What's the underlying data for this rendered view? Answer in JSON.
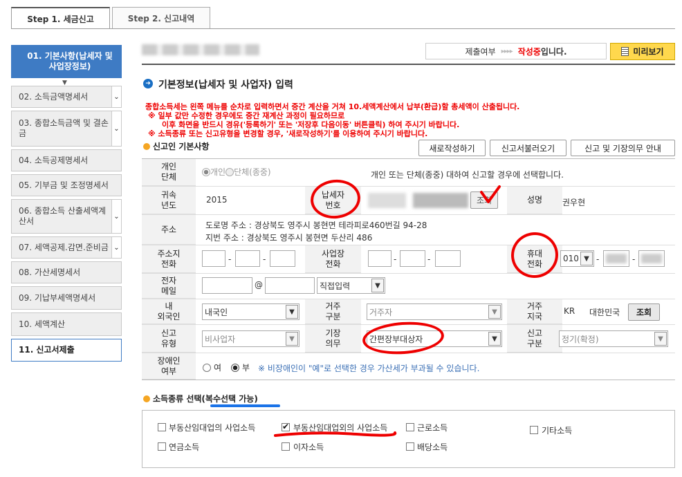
{
  "tabs": [
    "Step 1. 세금신고",
    "Step 2. 신고내역"
  ],
  "sidebar": [
    {
      "label": "01. 기본사항(납세자 및 사업장정보)",
      "state": "active"
    },
    {
      "label": "02. 소득금액명세서",
      "state": "dropdown"
    },
    {
      "label": "03. 종합소득금액 및 결손금",
      "state": "dropdown"
    },
    {
      "label": "04. 소득공제명세서",
      "state": "normal"
    },
    {
      "label": "05. 기부금 및 조정명세서",
      "state": "normal"
    },
    {
      "label": "06. 종합소득 산출세액계산서",
      "state": "dropdown"
    },
    {
      "label": "07. 세액공제.감면.준비금",
      "state": "dropdown"
    },
    {
      "label": "08. 가산세명세서",
      "state": "normal"
    },
    {
      "label": "09. 기납부세액명세서",
      "state": "normal"
    },
    {
      "label": "10. 세액계산",
      "state": "normal"
    },
    {
      "label": "11. 신고서제출",
      "state": "current"
    }
  ],
  "status": {
    "label": "제출여부",
    "arrows": "▸▸▸▸",
    "value": "작성중",
    "suffix": "입니다."
  },
  "preview_button": "미리보기",
  "section_title": "기본정보(납세자 및 사업자) 입력",
  "notices": [
    "종합소득세는 왼쪽 메뉴를 순차로 입력하면서 중간 계산을 거쳐 10.세액계산에서 납부(환급)할 총세액이 산출됩니다.",
    "※ 일부 값만 수정한 경우에도 중간 재계산 과정이 필요하므로",
    "이후 화면을 반드시 경유('등록하기' 또는 '저장후 다음이동' 버튼클릭) 하여 주시기 바랍니다.",
    "※ 소득종류 또는 신고유형을 변경할 경우, '새로작성하기'를 이용하여 주시기 바랍니다."
  ],
  "reporter": {
    "title": "신고인 기본사항",
    "buttons": [
      "새로작성하기",
      "신고서불러오기",
      "신고 및 기장의무 안내"
    ]
  },
  "form": {
    "individual_label": "개인\n단체",
    "radio_individual": "개인",
    "radio_group": "단체(종중)",
    "individual_help": "개인 또는 단체(종중) 대하여 신고할 경우에 선택합니다.",
    "year_label": "귀속\n년도",
    "year_value": "2015",
    "taxpayer_no_label": "납세자\n번호",
    "lookup_button": "조회",
    "name_label": "성명",
    "name_value": "권우현",
    "address_label": "주소",
    "road_address": "도로명 주소 :  경상북도 영주시 봉현면 테라피로460번길 94-28",
    "lot_address": "지번 주소 :  경상북도 영주시 봉현면 두산리 486",
    "home_phone_label": "주소지\n전화",
    "biz_phone_label": "사업장\n전화",
    "mobile_label": "휴대\n전화",
    "mobile_prefix": "010",
    "email_label": "전자\n메일",
    "email_at": "@",
    "email_domain": "직접입력",
    "foreigner_label": "내\n외국인",
    "foreigner_value": "내국인",
    "residence_label": "거주\n구분",
    "residence_value": "거주자",
    "country_label": "거주\n지국",
    "country_code": "KR",
    "country_name": "대한민국",
    "country_button": "조회",
    "report_type_label": "신고\n유형",
    "report_type_value": "비사업자",
    "bookkeeping_label": "기장\n의무",
    "bookkeeping_value": "간편장부대상자",
    "report_class_label": "신고\n구분",
    "report_class_value": "정기(확정)",
    "disabled_label": "장애인\n여부",
    "radio_yes": "여",
    "radio_no": "부",
    "disabled_note": "※ 비장애인이 \"예\"로 선택한 경우 가산세가 부과될 수 있습니다.",
    "dash": "-"
  },
  "income": {
    "title": "소득종류 선택(복수선택 가능)",
    "items": [
      {
        "label": "부동산임대업의 사업소득",
        "checked": false
      },
      {
        "label": "부동산임대업외의 사업소득",
        "checked": true
      },
      {
        "label": "근로소득",
        "checked": false
      },
      {
        "label": "기타소득",
        "checked": false
      },
      {
        "label": "연금소득",
        "checked": false
      },
      {
        "label": "이자소득",
        "checked": false
      },
      {
        "label": "배당소득",
        "checked": false
      }
    ]
  },
  "colors": {
    "accent": "#3e7bc4",
    "notice": "#e00000",
    "annotation": "#e00000",
    "underline": "#1a73e8"
  }
}
